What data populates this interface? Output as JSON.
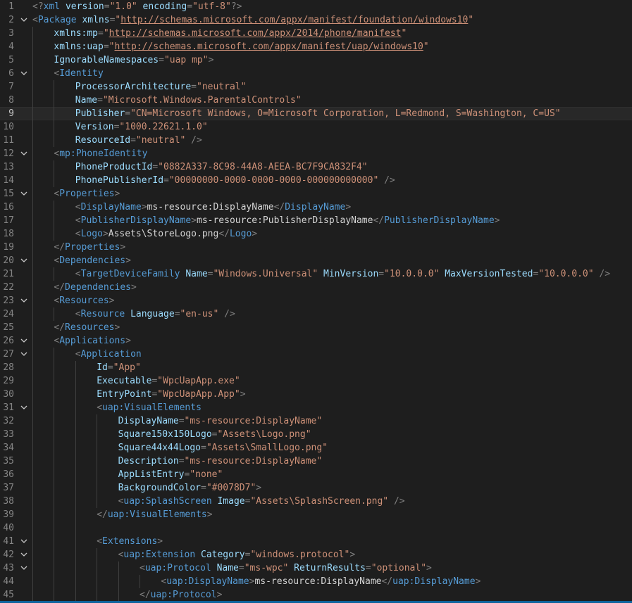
{
  "editor": {
    "language": "xml",
    "current_line": 9,
    "lines": [
      {
        "n": "1",
        "indent": 0,
        "fold": false,
        "tokens": [
          [
            "punc",
            "<?"
          ],
          [
            "tag",
            "xml"
          ],
          [
            "attr",
            " version"
          ],
          [
            "punc",
            "="
          ],
          [
            "str",
            "\"1.0\""
          ],
          [
            "attr",
            " encoding"
          ],
          [
            "punc",
            "="
          ],
          [
            "str",
            "\"utf-8\""
          ],
          [
            "punc",
            "?>"
          ]
        ]
      },
      {
        "n": "2",
        "indent": 0,
        "fold": true,
        "tokens": [
          [
            "punc",
            "<"
          ],
          [
            "tag",
            "Package"
          ],
          [
            "attr",
            " xmlns"
          ],
          [
            "punc",
            "="
          ],
          [
            "str",
            "\""
          ],
          [
            "url",
            "http://schemas.microsoft.com/appx/manifest/foundation/windows10"
          ],
          [
            "str",
            "\""
          ]
        ]
      },
      {
        "n": "3",
        "indent": 1,
        "fold": false,
        "tokens": [
          [
            "attr",
            "xmlns:mp"
          ],
          [
            "punc",
            "="
          ],
          [
            "str",
            "\""
          ],
          [
            "url",
            "http://schemas.microsoft.com/appx/2014/phone/manifest"
          ],
          [
            "str",
            "\""
          ]
        ]
      },
      {
        "n": "4",
        "indent": 1,
        "fold": false,
        "tokens": [
          [
            "attr",
            "xmlns:uap"
          ],
          [
            "punc",
            "="
          ],
          [
            "str",
            "\""
          ],
          [
            "url",
            "http://schemas.microsoft.com/appx/manifest/uap/windows10"
          ],
          [
            "str",
            "\""
          ]
        ]
      },
      {
        "n": "5",
        "indent": 1,
        "fold": false,
        "tokens": [
          [
            "attr",
            "IgnorableNamespaces"
          ],
          [
            "punc",
            "="
          ],
          [
            "str",
            "\"uap mp\""
          ],
          [
            "punc",
            ">"
          ]
        ]
      },
      {
        "n": "6",
        "indent": 1,
        "fold": true,
        "tokens": [
          [
            "punc",
            "<"
          ],
          [
            "tag",
            "Identity"
          ]
        ]
      },
      {
        "n": "7",
        "indent": 2,
        "fold": false,
        "tokens": [
          [
            "attr",
            "ProcessorArchitecture"
          ],
          [
            "punc",
            "="
          ],
          [
            "str",
            "\"neutral\""
          ]
        ]
      },
      {
        "n": "8",
        "indent": 2,
        "fold": false,
        "tokens": [
          [
            "attr",
            "Name"
          ],
          [
            "punc",
            "="
          ],
          [
            "str",
            "\"Microsoft.Windows.ParentalControls\""
          ]
        ]
      },
      {
        "n": "9",
        "indent": 2,
        "fold": false,
        "tokens": [
          [
            "attr",
            "Publisher"
          ],
          [
            "punc",
            "="
          ],
          [
            "str",
            "\"CN=Microsoft Windows, O=Microsoft Corporation, L=Redmond, S=Washington, C=US\""
          ]
        ]
      },
      {
        "n": "10",
        "indent": 2,
        "fold": false,
        "tokens": [
          [
            "attr",
            "Version"
          ],
          [
            "punc",
            "="
          ],
          [
            "str",
            "\"1000.22621.1.0\""
          ]
        ]
      },
      {
        "n": "11",
        "indent": 2,
        "fold": false,
        "tokens": [
          [
            "attr",
            "ResourceId"
          ],
          [
            "punc",
            "="
          ],
          [
            "str",
            "\"neutral\""
          ],
          [
            "punc",
            " />"
          ]
        ]
      },
      {
        "n": "12",
        "indent": 1,
        "fold": true,
        "tokens": [
          [
            "punc",
            "<"
          ],
          [
            "tag",
            "mp:PhoneIdentity"
          ]
        ]
      },
      {
        "n": "13",
        "indent": 2,
        "fold": false,
        "tokens": [
          [
            "attr",
            "PhoneProductId"
          ],
          [
            "punc",
            "="
          ],
          [
            "str",
            "\"0882A337-8C98-44A8-AEEA-BC7F9CA832F4\""
          ]
        ]
      },
      {
        "n": "14",
        "indent": 2,
        "fold": false,
        "tokens": [
          [
            "attr",
            "PhonePublisherId"
          ],
          [
            "punc",
            "="
          ],
          [
            "str",
            "\"00000000-0000-0000-0000-000000000000\""
          ],
          [
            "punc",
            " />"
          ]
        ]
      },
      {
        "n": "15",
        "indent": 1,
        "fold": true,
        "tokens": [
          [
            "punc",
            "<"
          ],
          [
            "tag",
            "Properties"
          ],
          [
            "punc",
            ">"
          ]
        ]
      },
      {
        "n": "16",
        "indent": 2,
        "fold": false,
        "tokens": [
          [
            "punc",
            "<"
          ],
          [
            "tag",
            "DisplayName"
          ],
          [
            "punc",
            ">"
          ],
          [
            "text",
            "ms-resource:DisplayName"
          ],
          [
            "punc",
            "</"
          ],
          [
            "tag",
            "DisplayName"
          ],
          [
            "punc",
            ">"
          ]
        ]
      },
      {
        "n": "17",
        "indent": 2,
        "fold": false,
        "tokens": [
          [
            "punc",
            "<"
          ],
          [
            "tag",
            "PublisherDisplayName"
          ],
          [
            "punc",
            ">"
          ],
          [
            "text",
            "ms-resource:PublisherDisplayName"
          ],
          [
            "punc",
            "</"
          ],
          [
            "tag",
            "PublisherDisplayName"
          ],
          [
            "punc",
            ">"
          ]
        ]
      },
      {
        "n": "18",
        "indent": 2,
        "fold": false,
        "tokens": [
          [
            "punc",
            "<"
          ],
          [
            "tag",
            "Logo"
          ],
          [
            "punc",
            ">"
          ],
          [
            "text",
            "Assets\\StoreLogo.png"
          ],
          [
            "punc",
            "</"
          ],
          [
            "tag",
            "Logo"
          ],
          [
            "punc",
            ">"
          ]
        ]
      },
      {
        "n": "19",
        "indent": 1,
        "fold": false,
        "tokens": [
          [
            "punc",
            "</"
          ],
          [
            "tag",
            "Properties"
          ],
          [
            "punc",
            ">"
          ]
        ]
      },
      {
        "n": "20",
        "indent": 1,
        "fold": true,
        "tokens": [
          [
            "punc",
            "<"
          ],
          [
            "tag",
            "Dependencies"
          ],
          [
            "punc",
            ">"
          ]
        ]
      },
      {
        "n": "21",
        "indent": 2,
        "fold": false,
        "tokens": [
          [
            "punc",
            "<"
          ],
          [
            "tag",
            "TargetDeviceFamily"
          ],
          [
            "attr",
            " Name"
          ],
          [
            "punc",
            "="
          ],
          [
            "str",
            "\"Windows.Universal\""
          ],
          [
            "attr",
            " MinVersion"
          ],
          [
            "punc",
            "="
          ],
          [
            "str",
            "\"10.0.0.0\""
          ],
          [
            "attr",
            " MaxVersionTested"
          ],
          [
            "punc",
            "="
          ],
          [
            "str",
            "\"10.0.0.0\""
          ],
          [
            "punc",
            " />"
          ]
        ]
      },
      {
        "n": "22",
        "indent": 1,
        "fold": false,
        "tokens": [
          [
            "punc",
            "</"
          ],
          [
            "tag",
            "Dependencies"
          ],
          [
            "punc",
            ">"
          ]
        ]
      },
      {
        "n": "23",
        "indent": 1,
        "fold": true,
        "tokens": [
          [
            "punc",
            "<"
          ],
          [
            "tag",
            "Resources"
          ],
          [
            "punc",
            ">"
          ]
        ]
      },
      {
        "n": "24",
        "indent": 2,
        "fold": false,
        "tokens": [
          [
            "punc",
            "<"
          ],
          [
            "tag",
            "Resource"
          ],
          [
            "attr",
            " Language"
          ],
          [
            "punc",
            "="
          ],
          [
            "str",
            "\"en-us\""
          ],
          [
            "punc",
            " />"
          ]
        ]
      },
      {
        "n": "25",
        "indent": 1,
        "fold": false,
        "tokens": [
          [
            "punc",
            "</"
          ],
          [
            "tag",
            "Resources"
          ],
          [
            "punc",
            ">"
          ]
        ]
      },
      {
        "n": "26",
        "indent": 1,
        "fold": true,
        "tokens": [
          [
            "punc",
            "<"
          ],
          [
            "tag",
            "Applications"
          ],
          [
            "punc",
            ">"
          ]
        ]
      },
      {
        "n": "27",
        "indent": 2,
        "fold": true,
        "tokens": [
          [
            "punc",
            "<"
          ],
          [
            "tag",
            "Application"
          ]
        ]
      },
      {
        "n": "28",
        "indent": 3,
        "fold": false,
        "tokens": [
          [
            "attr",
            "Id"
          ],
          [
            "punc",
            "="
          ],
          [
            "str",
            "\"App\""
          ]
        ]
      },
      {
        "n": "29",
        "indent": 3,
        "fold": false,
        "tokens": [
          [
            "attr",
            "Executable"
          ],
          [
            "punc",
            "="
          ],
          [
            "str",
            "\"WpcUapApp.exe\""
          ]
        ]
      },
      {
        "n": "30",
        "indent": 3,
        "fold": false,
        "tokens": [
          [
            "attr",
            "EntryPoint"
          ],
          [
            "punc",
            "="
          ],
          [
            "str",
            "\"WpcUapApp.App\""
          ],
          [
            "punc",
            ">"
          ]
        ]
      },
      {
        "n": "31",
        "indent": 3,
        "fold": true,
        "tokens": [
          [
            "punc",
            "<"
          ],
          [
            "tag",
            "uap:VisualElements"
          ]
        ]
      },
      {
        "n": "32",
        "indent": 4,
        "fold": false,
        "tokens": [
          [
            "attr",
            "DisplayName"
          ],
          [
            "punc",
            "="
          ],
          [
            "str",
            "\"ms-resource:DisplayName\""
          ]
        ]
      },
      {
        "n": "33",
        "indent": 4,
        "fold": false,
        "tokens": [
          [
            "attr",
            "Square150x150Logo"
          ],
          [
            "punc",
            "="
          ],
          [
            "str",
            "\"Assets\\Logo.png\""
          ]
        ]
      },
      {
        "n": "34",
        "indent": 4,
        "fold": false,
        "tokens": [
          [
            "attr",
            "Square44x44Logo"
          ],
          [
            "punc",
            "="
          ],
          [
            "str",
            "\"Assets\\SmallLogo.png\""
          ]
        ]
      },
      {
        "n": "35",
        "indent": 4,
        "fold": false,
        "tokens": [
          [
            "attr",
            "Description"
          ],
          [
            "punc",
            "="
          ],
          [
            "str",
            "\"ms-resource:DisplayName\""
          ]
        ]
      },
      {
        "n": "36",
        "indent": 4,
        "fold": false,
        "tokens": [
          [
            "attr",
            "AppListEntry"
          ],
          [
            "punc",
            "="
          ],
          [
            "str",
            "\"none\""
          ]
        ]
      },
      {
        "n": "37",
        "indent": 4,
        "fold": false,
        "tokens": [
          [
            "attr",
            "BackgroundColor"
          ],
          [
            "punc",
            "="
          ],
          [
            "str",
            "\"#0078D7\""
          ],
          [
            "punc",
            ">"
          ]
        ]
      },
      {
        "n": "38",
        "indent": 4,
        "fold": false,
        "tokens": [
          [
            "punc",
            "<"
          ],
          [
            "tag",
            "uap:SplashScreen"
          ],
          [
            "attr",
            " Image"
          ],
          [
            "punc",
            "="
          ],
          [
            "str",
            "\"Assets\\SplashScreen.png\""
          ],
          [
            "punc",
            " />"
          ]
        ]
      },
      {
        "n": "39",
        "indent": 3,
        "fold": false,
        "tokens": [
          [
            "punc",
            "</"
          ],
          [
            "tag",
            "uap:VisualElements"
          ],
          [
            "punc",
            ">"
          ]
        ]
      },
      {
        "n": "40",
        "indent": 3,
        "fold": false,
        "tokens": []
      },
      {
        "n": "41",
        "indent": 3,
        "fold": true,
        "tokens": [
          [
            "punc",
            "<"
          ],
          [
            "tag",
            "Extensions"
          ],
          [
            "punc",
            ">"
          ]
        ]
      },
      {
        "n": "42",
        "indent": 4,
        "fold": true,
        "tokens": [
          [
            "punc",
            "<"
          ],
          [
            "tag",
            "uap:Extension"
          ],
          [
            "attr",
            " Category"
          ],
          [
            "punc",
            "="
          ],
          [
            "str",
            "\"windows.protocol\""
          ],
          [
            "punc",
            ">"
          ]
        ]
      },
      {
        "n": "43",
        "indent": 5,
        "fold": true,
        "tokens": [
          [
            "punc",
            "<"
          ],
          [
            "tag",
            "uap:Protocol"
          ],
          [
            "attr",
            " Name"
          ],
          [
            "punc",
            "="
          ],
          [
            "str",
            "\"ms-wpc\""
          ],
          [
            "attr",
            " ReturnResults"
          ],
          [
            "punc",
            "="
          ],
          [
            "str",
            "\"optional\""
          ],
          [
            "punc",
            ">"
          ]
        ]
      },
      {
        "n": "44",
        "indent": 6,
        "fold": false,
        "tokens": [
          [
            "punc",
            "<"
          ],
          [
            "tag",
            "uap:DisplayName"
          ],
          [
            "punc",
            ">"
          ],
          [
            "text",
            "ms-resource:DisplayName"
          ],
          [
            "punc",
            "</"
          ],
          [
            "tag",
            "uap:DisplayName"
          ],
          [
            "punc",
            ">"
          ]
        ]
      },
      {
        "n": "45",
        "indent": 5,
        "fold": false,
        "tokens": [
          [
            "punc",
            "</"
          ],
          [
            "tag",
            "uap:Protocol"
          ],
          [
            "punc",
            ">"
          ]
        ]
      }
    ]
  }
}
